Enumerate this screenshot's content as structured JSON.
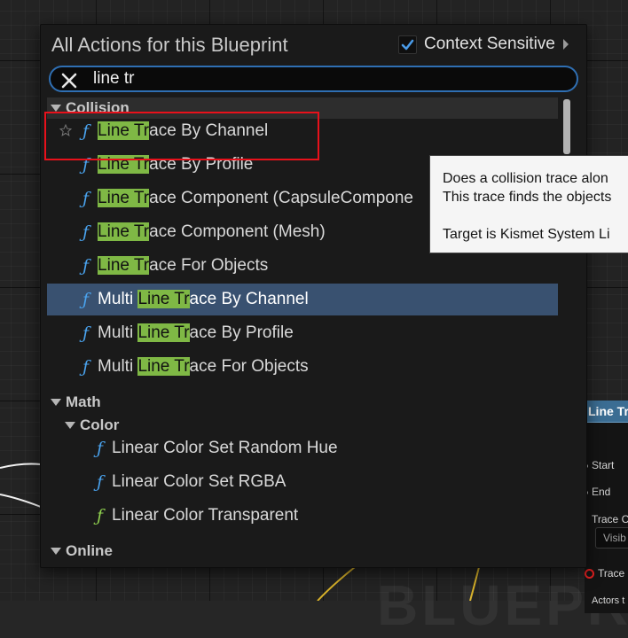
{
  "menu": {
    "title": "All Actions for this Blueprint",
    "context_sensitive_label": "Context Sensitive",
    "context_sensitive_checked": true,
    "search_value": "line tr",
    "search_placeholder": ""
  },
  "items": [
    {
      "type": "category",
      "label": "Collision"
    },
    {
      "type": "function",
      "pre": "",
      "match": "Line Tr",
      "post": "ace By Channel",
      "icon": "function-icon",
      "favorite_star": true
    },
    {
      "type": "function",
      "pre": "",
      "match": "Line Tr",
      "post": "ace By Profile",
      "icon": "function-icon"
    },
    {
      "type": "function",
      "pre": "",
      "match": "Line Tr",
      "post": "ace Component (CapsuleCompone",
      "icon": "function-icon"
    },
    {
      "type": "function",
      "pre": "",
      "match": "Line Tr",
      "post": "ace Component (Mesh)",
      "icon": "function-icon"
    },
    {
      "type": "function",
      "pre": "",
      "match": "Line Tr",
      "post": "ace For Objects",
      "icon": "function-icon"
    },
    {
      "type": "function",
      "pre": "Multi ",
      "match": "Line Tr",
      "post": "ace By Channel",
      "icon": "function-icon",
      "selected": true
    },
    {
      "type": "function",
      "pre": "Multi ",
      "match": "Line Tr",
      "post": "ace By Profile",
      "icon": "function-icon"
    },
    {
      "type": "function",
      "pre": "Multi ",
      "match": "Line Tr",
      "post": "ace For Objects",
      "icon": "function-icon"
    },
    {
      "type": "category",
      "label": "Math"
    },
    {
      "type": "subcategory",
      "label": "Color"
    },
    {
      "type": "function",
      "label": "Linear Color Set Random Hue",
      "icon": "function-icon"
    },
    {
      "type": "function",
      "label": "Linear Color Set RGBA",
      "icon": "function-icon"
    },
    {
      "type": "function",
      "label": "Linear Color Transparent",
      "icon": "pure-function-icon"
    },
    {
      "type": "category",
      "label": "Online"
    }
  ],
  "tooltip": {
    "line1": "Does a collision trace alon",
    "line2": "This trace finds the objects",
    "line3": "Target is Kismet System Li"
  },
  "node": {
    "title": "Line Tra",
    "pin_start": "Start",
    "pin_end": "End",
    "pin_trace_channel": "Trace C",
    "channel_value": "Visib",
    "pin_trace_complex": "Trace C",
    "pin_actors": "Actors t"
  },
  "background": {
    "watermark": "BLUEPR"
  },
  "colors": {
    "accent_blue": "#2f6fb3",
    "match_highlight": "#7fb845",
    "selected_row": "#395170",
    "function_icon": "#4aa3ee",
    "pure_function_icon": "#8fd04f",
    "annotation_red": "#e8111b",
    "node_header": "#3b6d93"
  }
}
